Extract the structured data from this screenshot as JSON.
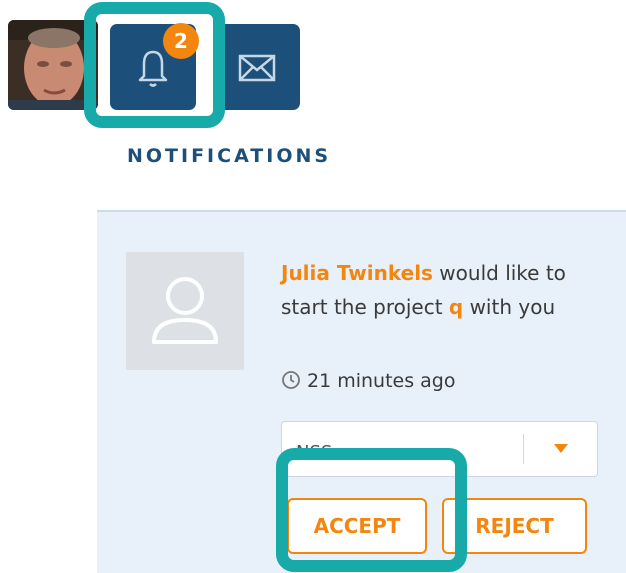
{
  "header": {
    "notification_count": "2",
    "user_avatar_icon": "user-photo",
    "bell_icon": "bell-icon",
    "mail_icon": "mail-icon"
  },
  "section": {
    "title": "NOTIFICATIONS"
  },
  "notification": {
    "sender": "Julia Twinkels",
    "text_before": " would like to start the project ",
    "project": "q",
    "text_after": " with you",
    "timestamp": "21 minutes ago",
    "select_value": "NSS",
    "accept_label": "ACCEPT",
    "reject_label": "REJECT"
  },
  "colors": {
    "navy": "#1c4f79",
    "orange": "#f3860f",
    "teal_highlight": "#17aaa9",
    "card_bg": "#e8f1f9"
  }
}
